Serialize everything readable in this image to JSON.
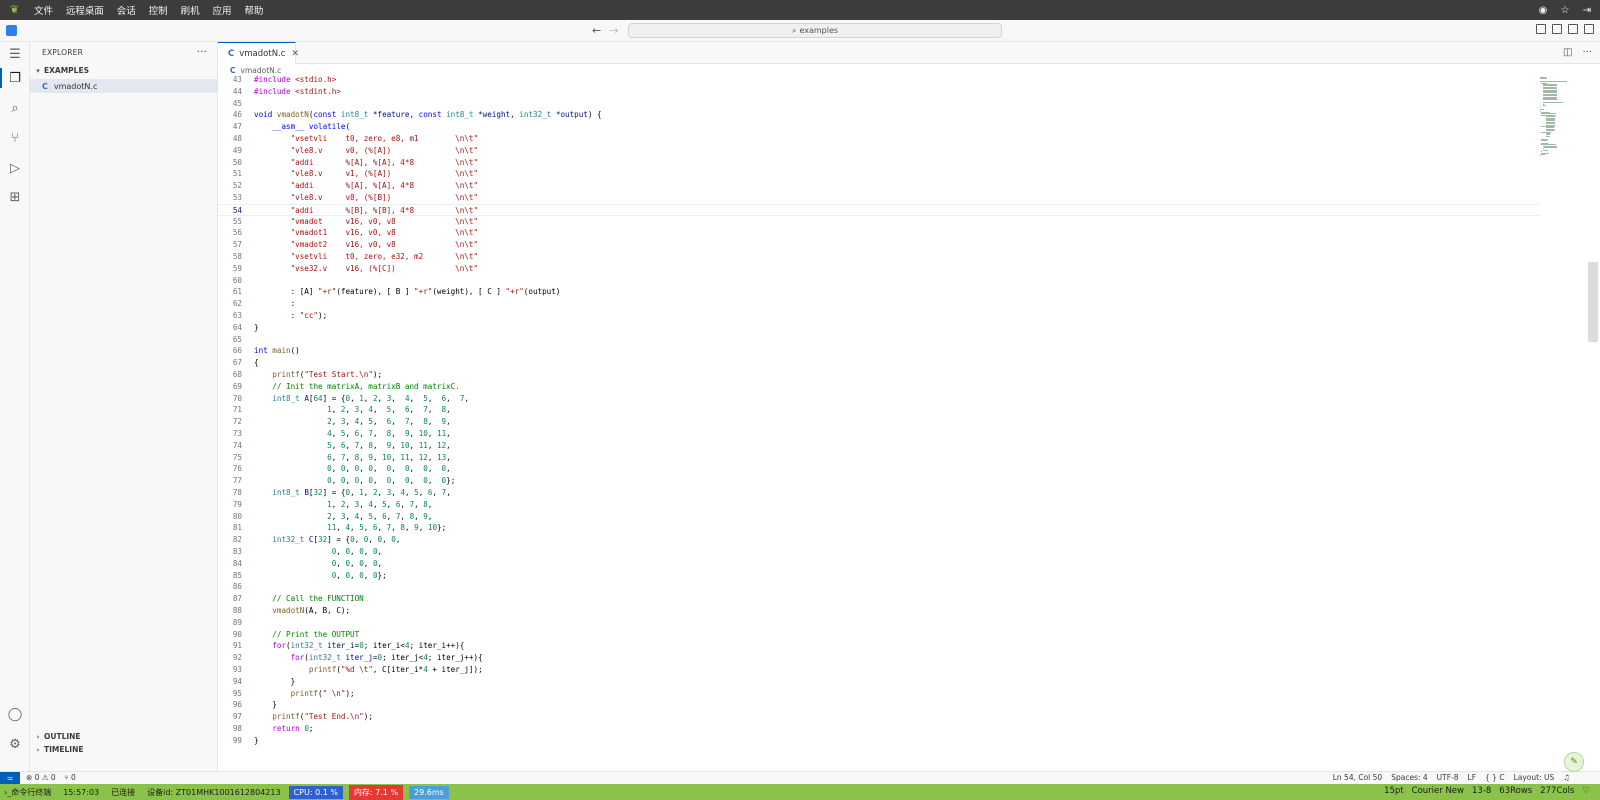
{
  "remote": {
    "menu": [
      "文件",
      "远程桌面",
      "会话",
      "控制",
      "刷机",
      "应用",
      "帮助"
    ]
  },
  "titlebar": {
    "search_text": "examples"
  },
  "sidebar": {
    "title": "EXPLORER",
    "folder": "EXAMPLES",
    "file": "vmadotN.c",
    "outline": "OUTLINE",
    "timeline": "TIMELINE"
  },
  "editor": {
    "tab_label": "vmadotN.c",
    "breadcrumb": "vmadotN.c",
    "lines": [
      {
        "n": "43",
        "html": "<span class=\"p\">#include</span> <span class=\"s\">&lt;stdio.h&gt;</span>"
      },
      {
        "n": "44",
        "html": "<span class=\"p\">#include</span> <span class=\"s\">&lt;stdint.h&gt;</span>"
      },
      {
        "n": "45",
        "html": ""
      },
      {
        "n": "46",
        "html": "<span class=\"k\">void</span> <span class=\"f\">vmadotN</span>(<span class=\"k\">const</span> <span class=\"t\">int8_t</span> <span class=\"v\">*feature</span>, <span class=\"k\">const</span> <span class=\"t\">int8_t</span> <span class=\"v\">*weight</span>, <span class=\"t\">int32_t</span> <span class=\"v\">*output</span>) {"
      },
      {
        "n": "47",
        "html": "    <span class=\"k\">__asm__</span> <span class=\"k\">volatile</span>("
      },
      {
        "n": "48",
        "html": "        <span class=\"s\">\"vsetvli    t0, zero, e8, m1        \\n\\t\"</span>"
      },
      {
        "n": "49",
        "html": "        <span class=\"s\">\"vle8.v     v0, (%[A])              \\n\\t\"</span>"
      },
      {
        "n": "50",
        "html": "        <span class=\"s\">\"addi       %[A], %[A], 4*8         \\n\\t\"</span>"
      },
      {
        "n": "51",
        "html": "        <span class=\"s\">\"vle8.v     v1, (%[A])              \\n\\t\"</span>"
      },
      {
        "n": "52",
        "html": "        <span class=\"s\">\"addi       %[A], %[A], 4*8         \\n\\t\"</span>"
      },
      {
        "n": "53",
        "html": "        <span class=\"s\">\"vle8.v     v8, (%[B])              \\n\\t\"</span>"
      },
      {
        "n": "54",
        "html": "        <span class=\"s\">\"addi       %[B], %[B], 4*8         \\n\\t\"</span>"
      },
      {
        "n": "55",
        "html": "        <span class=\"s\">\"vmadot     v16, v0, v8             \\n\\t\"</span>"
      },
      {
        "n": "56",
        "html": "        <span class=\"s\">\"vmadot1    v16, v0, v8             \\n\\t\"</span>"
      },
      {
        "n": "57",
        "html": "        <span class=\"s\">\"vmadot2    v16, v0, v8             \\n\\t\"</span>"
      },
      {
        "n": "58",
        "html": "        <span class=\"s\">\"vsetvli    t0, zero, e32, m2       \\n\\t\"</span>"
      },
      {
        "n": "59",
        "html": "        <span class=\"s\">\"vse32.v    v16, (%[C])             \\n\\t\"</span>"
      },
      {
        "n": "60",
        "html": ""
      },
      {
        "n": "61",
        "html": "        : [A] <span class=\"s\">\"+r\"</span>(feature), [ B ] <span class=\"s\">\"+r\"</span>(weight), [ C ] <span class=\"s\">\"+r\"</span>(output)"
      },
      {
        "n": "62",
        "html": "        :"
      },
      {
        "n": "63",
        "html": "        : <span class=\"s\">\"cc\"</span>);"
      },
      {
        "n": "64",
        "html": "}"
      },
      {
        "n": "65",
        "html": ""
      },
      {
        "n": "66",
        "html": "<span class=\"k\">int</span> <span class=\"f\">main</span>()"
      },
      {
        "n": "67",
        "html": "{"
      },
      {
        "n": "68",
        "html": "    <span class=\"f\">printf</span>(<span class=\"s\">\"Test Start.\\n\"</span>);"
      },
      {
        "n": "69",
        "html": "    <span class=\"c\">// Init the matrixA, matrixB and matrixC.</span>"
      },
      {
        "n": "70",
        "html": "    <span class=\"t\">int8_t</span> <span class=\"v\">A</span>[<span class=\"n\">64</span>] = {<span class=\"n\">0</span>, <span class=\"n\">1</span>, <span class=\"n\">2</span>, <span class=\"n\">3</span>,  <span class=\"n\">4</span>,  <span class=\"n\">5</span>,  <span class=\"n\">6</span>,  <span class=\"n\">7</span>,"
      },
      {
        "n": "71",
        "html": "                <span class=\"n\">1</span>, <span class=\"n\">2</span>, <span class=\"n\">3</span>, <span class=\"n\">4</span>,  <span class=\"n\">5</span>,  <span class=\"n\">6</span>,  <span class=\"n\">7</span>,  <span class=\"n\">8</span>,"
      },
      {
        "n": "72",
        "html": "                <span class=\"n\">2</span>, <span class=\"n\">3</span>, <span class=\"n\">4</span>, <span class=\"n\">5</span>,  <span class=\"n\">6</span>,  <span class=\"n\">7</span>,  <span class=\"n\">8</span>,  <span class=\"n\">9</span>,"
      },
      {
        "n": "73",
        "html": "                <span class=\"n\">4</span>, <span class=\"n\">5</span>, <span class=\"n\">6</span>, <span class=\"n\">7</span>,  <span class=\"n\">8</span>,  <span class=\"n\">9</span>, <span class=\"n\">10</span>, <span class=\"n\">11</span>,"
      },
      {
        "n": "74",
        "html": "                <span class=\"n\">5</span>, <span class=\"n\">6</span>, <span class=\"n\">7</span>, <span class=\"n\">8</span>,  <span class=\"n\">9</span>, <span class=\"n\">10</span>, <span class=\"n\">11</span>, <span class=\"n\">12</span>,"
      },
      {
        "n": "75",
        "html": "                <span class=\"n\">6</span>, <span class=\"n\">7</span>, <span class=\"n\">8</span>, <span class=\"n\">9</span>, <span class=\"n\">10</span>, <span class=\"n\">11</span>, <span class=\"n\">12</span>, <span class=\"n\">13</span>,"
      },
      {
        "n": "76",
        "html": "                <span class=\"n\">0</span>, <span class=\"n\">0</span>, <span class=\"n\">0</span>, <span class=\"n\">0</span>,  <span class=\"n\">0</span>,  <span class=\"n\">0</span>,  <span class=\"n\">0</span>,  <span class=\"n\">0</span>,"
      },
      {
        "n": "77",
        "html": "                <span class=\"n\">0</span>, <span class=\"n\">0</span>, <span class=\"n\">0</span>, <span class=\"n\">0</span>,  <span class=\"n\">0</span>,  <span class=\"n\">0</span>,  <span class=\"n\">0</span>,  <span class=\"n\">0</span>};"
      },
      {
        "n": "78",
        "html": "    <span class=\"t\">int8_t</span> <span class=\"v\">B</span>[<span class=\"n\">32</span>] = {<span class=\"n\">0</span>, <span class=\"n\">1</span>, <span class=\"n\">2</span>, <span class=\"n\">3</span>, <span class=\"n\">4</span>, <span class=\"n\">5</span>, <span class=\"n\">6</span>, <span class=\"n\">7</span>,"
      },
      {
        "n": "79",
        "html": "                <span class=\"n\">1</span>, <span class=\"n\">2</span>, <span class=\"n\">3</span>, <span class=\"n\">4</span>, <span class=\"n\">5</span>, <span class=\"n\">6</span>, <span class=\"n\">7</span>, <span class=\"n\">8</span>,"
      },
      {
        "n": "80",
        "html": "                <span class=\"n\">2</span>, <span class=\"n\">3</span>, <span class=\"n\">4</span>, <span class=\"n\">5</span>, <span class=\"n\">6</span>, <span class=\"n\">7</span>, <span class=\"n\">8</span>, <span class=\"n\">9</span>,"
      },
      {
        "n": "81",
        "html": "                <span class=\"n\">11</span>, <span class=\"n\">4</span>, <span class=\"n\">5</span>, <span class=\"n\">6</span>, <span class=\"n\">7</span>, <span class=\"n\">8</span>, <span class=\"n\">9</span>, <span class=\"n\">10</span>};"
      },
      {
        "n": "82",
        "html": "    <span class=\"t\">int32_t</span> <span class=\"v\">C</span>[<span class=\"n\">32</span>] = {<span class=\"n\">0</span>, <span class=\"n\">0</span>, <span class=\"n\">0</span>, <span class=\"n\">0</span>,"
      },
      {
        "n": "83",
        "html": "                 <span class=\"n\">0</span>, <span class=\"n\">0</span>, <span class=\"n\">0</span>, <span class=\"n\">0</span>,"
      },
      {
        "n": "84",
        "html": "                 <span class=\"n\">0</span>, <span class=\"n\">0</span>, <span class=\"n\">0</span>, <span class=\"n\">0</span>,"
      },
      {
        "n": "85",
        "html": "                 <span class=\"n\">0</span>, <span class=\"n\">0</span>, <span class=\"n\">0</span>, <span class=\"n\">0</span>};"
      },
      {
        "n": "86",
        "html": ""
      },
      {
        "n": "87",
        "html": "    <span class=\"c\">// Call the FUNCTION</span>"
      },
      {
        "n": "88",
        "html": "    <span class=\"f\">vmadotN</span>(A, B, C);"
      },
      {
        "n": "89",
        "html": ""
      },
      {
        "n": "90",
        "html": "    <span class=\"c\">// Print the OUTPUT</span>"
      },
      {
        "n": "91",
        "html": "    <span class=\"p\">for</span>(<span class=\"t\">int32_t</span> <span class=\"v\">iter_i</span>=<span class=\"n\">0</span>; iter_i&lt;<span class=\"n\">4</span>; iter_i++){"
      },
      {
        "n": "92",
        "html": "        <span class=\"p\">for</span>(<span class=\"t\">int32_t</span> <span class=\"v\">iter_j</span>=<span class=\"n\">0</span>; iter_j&lt;<span class=\"n\">4</span>; iter_j++){"
      },
      {
        "n": "93",
        "html": "            <span class=\"f\">printf</span>(<span class=\"s\">\"%d \\t\"</span>, C[iter_i*<span class=\"n\">4</span> + iter_j]);"
      },
      {
        "n": "94",
        "html": "        }"
      },
      {
        "n": "95",
        "html": "        <span class=\"f\">printf</span>(<span class=\"s\">\" \\n\"</span>);"
      },
      {
        "n": "96",
        "html": "    }"
      },
      {
        "n": "97",
        "html": "    <span class=\"f\">printf</span>(<span class=\"s\">\"Test End.\\n\"</span>);"
      },
      {
        "n": "98",
        "html": "    <span class=\"p\">return</span> <span class=\"n\">0</span>;"
      },
      {
        "n": "99",
        "html": "}"
      }
    ],
    "current_line": "54"
  },
  "statusbar": {
    "problems": "⊗ 0 ⚠ 0",
    "ports": "⑂ 0",
    "position": "Ln 54, Col 50",
    "spaces": "Spaces: 4",
    "encoding": "UTF-8",
    "eol": "LF",
    "language": "{ } C",
    "layout": "Layout: US"
  },
  "footer": {
    "terminal": "命令行终端",
    "time": "15:57:03",
    "connection": "已连接",
    "device": "设备id: ZT01MHK1001612804213",
    "cpu": "CPU: 0.1 %",
    "memory": "内存: 7.1 %",
    "latency": "29.6ms",
    "font_size": "15pt",
    "font_name": "Courier New",
    "size": "13-8",
    "rows": "63Rows",
    "cols": "277Cols"
  },
  "colors": {
    "accent": "#005fb8",
    "footer_bg": "#8bc34a",
    "cpu_bg": "#2f5fd0",
    "mem_bg": "#e53935"
  }
}
